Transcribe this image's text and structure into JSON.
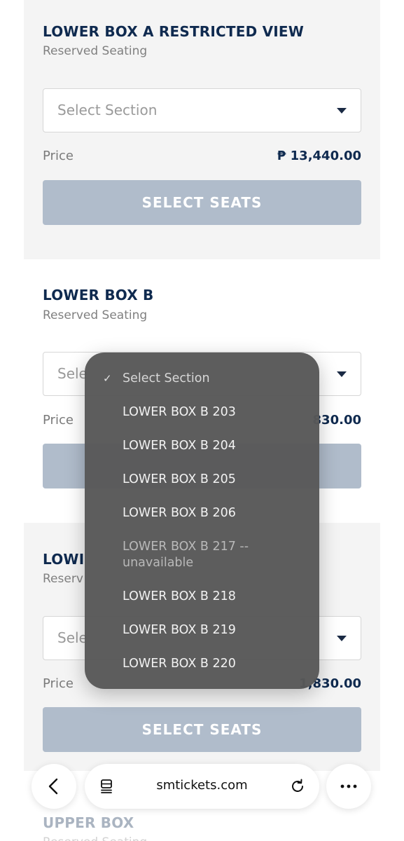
{
  "sections": [
    {
      "title": "LOWER BOX A RESTRICTED VIEW",
      "subtitle": "Reserved Seating",
      "select_placeholder": "Select Section",
      "price_label": "Price",
      "price_value": "₱ 13,440.00",
      "button_label": "SELECT SEATS"
    },
    {
      "title": "LOWER BOX B",
      "subtitle": "Reserved Seating",
      "select_placeholder": "Sele",
      "price_label": "Price",
      "price_value": "830.00"
    },
    {
      "title": "LOWI",
      "subtitle": "Reserv",
      "select_placeholder": "Sele",
      "price_label": "Price",
      "price_value": "1,830.00",
      "button_label": "SELECT SEATS"
    },
    {
      "title": "UPPER BOX",
      "subtitle": "Reserved Seating"
    }
  ],
  "dropdown": {
    "options": [
      {
        "label": "Select Section",
        "selected": true
      },
      {
        "label": "LOWER BOX B 203"
      },
      {
        "label": "LOWER BOX B 204"
      },
      {
        "label": "LOWER BOX B 205"
      },
      {
        "label": "LOWER BOX B 206"
      },
      {
        "label": "LOWER BOX B 217 -- unavailable",
        "unavailable": true
      },
      {
        "label": "LOWER BOX B 218"
      },
      {
        "label": "LOWER BOX B 219"
      },
      {
        "label": "LOWER BOX B 220"
      }
    ],
    "check_glyph": "✓"
  },
  "browser_bar": {
    "url": "smtickets.com",
    "icons": [
      "chevron-left-icon",
      "page-menu-icon",
      "reload-icon",
      "more-icon"
    ]
  },
  "colors": {
    "title": "#0f2a4f",
    "button_disabled": "#b0bccb",
    "card_grey": "#f4f4f4",
    "dropdown_bg": "#585858"
  }
}
